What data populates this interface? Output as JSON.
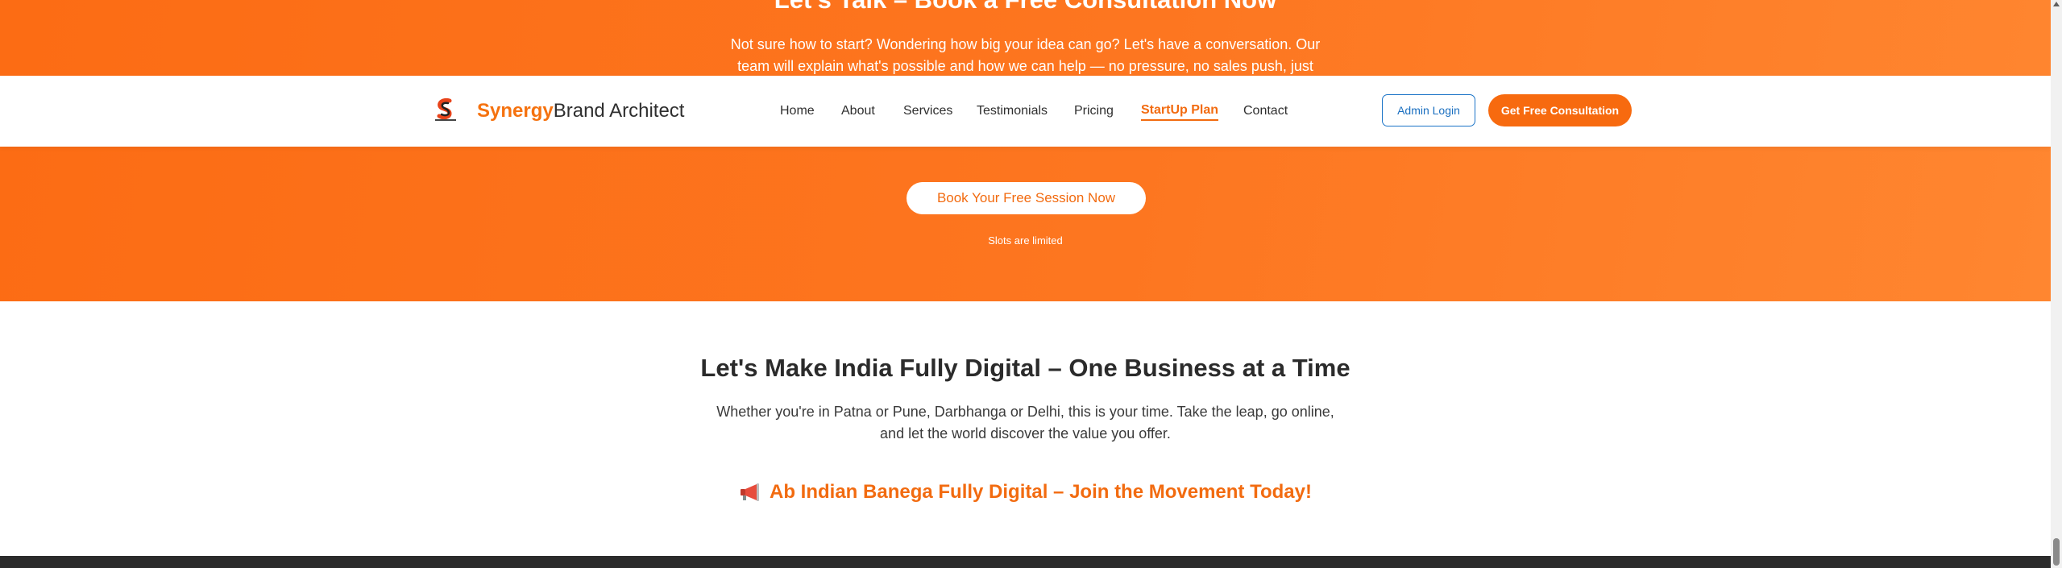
{
  "cta": {
    "title": "Let's Talk – Book a Free Consultation Now",
    "description_line1": "Not sure how to start? Wondering how big your idea can go? Let's have a conversation. Our",
    "description_line2": "team will explain what's possible and how we can help — no pressure, no sales push, just",
    "button_label": "Book Your Free Session Now",
    "note": "Slots are limited"
  },
  "header": {
    "logo_icon": "synergy-s-logo",
    "brand_part1": "Synergy",
    "brand_part2": "Brand Architect",
    "nav": [
      {
        "label": "Home"
      },
      {
        "label": "About"
      },
      {
        "label": "Services"
      },
      {
        "label": "Testimonials"
      },
      {
        "label": "Pricing"
      },
      {
        "label": "StartUp Plan",
        "active": true
      },
      {
        "label": "Contact"
      }
    ],
    "admin_button": "Admin Login",
    "consult_button": "Get Free Consultation"
  },
  "digital": {
    "title": "Let's Make India Fully Digital – One Business at a Time",
    "text_line1": "Whether you're in Patna or Pune, Darbhanga or Delhi, this is your time. Take the leap, go online,",
    "text_line2": "and let the world discover the value you offer.",
    "movement_icon": "megaphone-icon",
    "movement": "Ab Indian Banega Fully Digital – Join the Movement Today!"
  },
  "colors": {
    "accent": "#f26b10",
    "cta_bg": "#fc6c14",
    "admin_blue": "#1a73c7",
    "footer": "#2b2b2b"
  }
}
